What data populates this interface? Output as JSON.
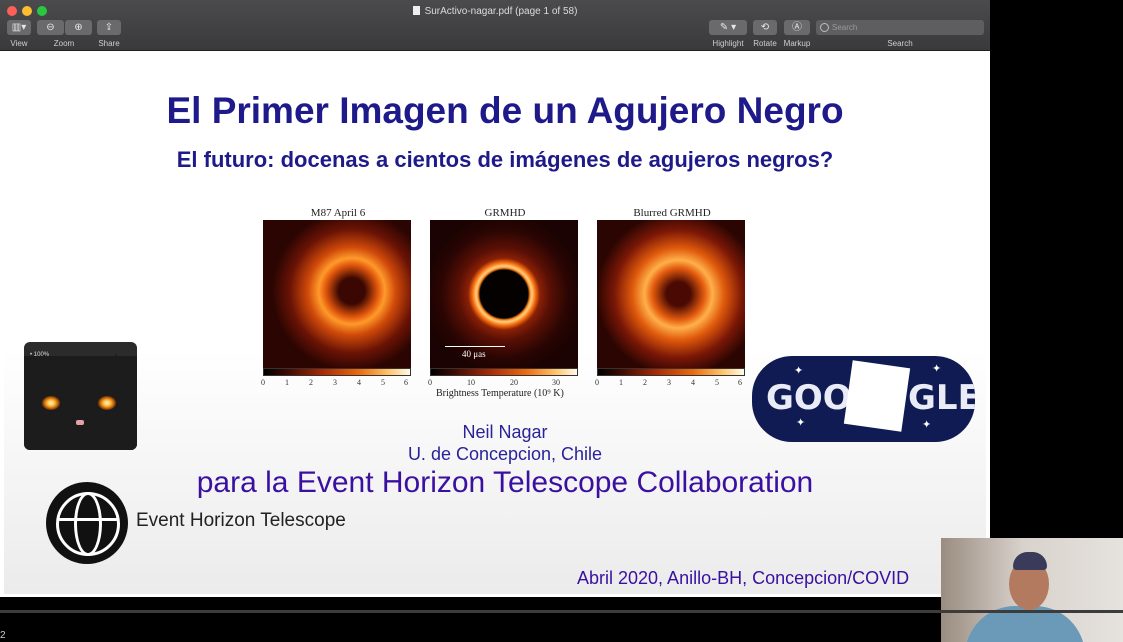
{
  "window": {
    "title": "SurActivo-nagar.pdf (page 1 of 58)"
  },
  "toolbar": {
    "view_label": "View",
    "zoom_label": "Zoom",
    "share_label": "Share",
    "highlight_label": "Highlight",
    "rotate_label": "Rotate",
    "markup_label": "Markup",
    "search_label": "Search",
    "search_placeholder": "Search"
  },
  "slide": {
    "title": "El Primer Imagen de un Agujero Negro",
    "subtitle": "El futuro: docenas a cientos de imágenes de agujeros negros?",
    "figures": [
      {
        "title": "M87 April 6",
        "ticks": [
          "0",
          "1",
          "2",
          "3",
          "4",
          "5",
          "6"
        ]
      },
      {
        "title": "GRMHD",
        "ticks": [
          "0",
          "10",
          "20",
          "30"
        ],
        "scale_label": "40 μas"
      },
      {
        "title": "Blurred GRMHD",
        "ticks": [
          "0",
          "1",
          "2",
          "3",
          "4",
          "5",
          "6"
        ]
      }
    ],
    "colorbar_label": "Brightness Temperature (10⁹ K)",
    "author": "Neil Nagar",
    "affiliation": "U. de Concepcion, Chile",
    "collaboration": "para la Event Horizon Telescope Collaboration",
    "eht_logo_text": "Event Horizon Telescope",
    "footer": "Abril 2020, Anillo-BH, Concepcion/COVID"
  },
  "overlays": {
    "cat_zoom": "• 100%",
    "google_left": "GOO",
    "google_right": "GLE"
  },
  "bottom_char": "2"
}
